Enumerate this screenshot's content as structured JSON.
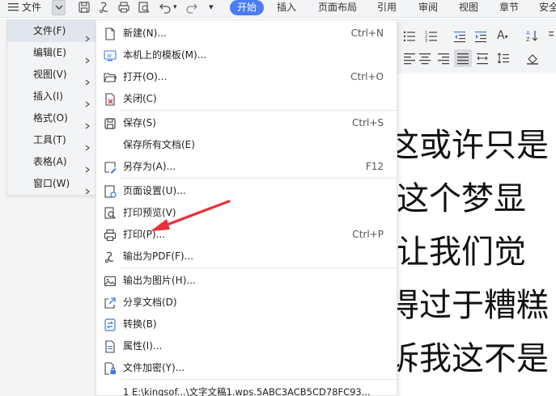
{
  "toolbar": {
    "file_label": "文件",
    "tab_start": "开始",
    "tabs": [
      "插入",
      "页面布局",
      "引用",
      "审阅",
      "视图",
      "章节",
      "安全"
    ]
  },
  "left_menu": {
    "items": [
      {
        "label": "文件(F)",
        "active": true
      },
      {
        "label": "编辑(E)"
      },
      {
        "label": "视图(V)"
      },
      {
        "label": "插入(I)"
      },
      {
        "label": "格式(O)"
      },
      {
        "label": "工具(T)"
      },
      {
        "label": "表格(A)"
      },
      {
        "label": "窗口(W)"
      }
    ]
  },
  "file_menu": {
    "new": {
      "label": "新建(N)...",
      "shortcut": "Ctrl+N"
    },
    "template": {
      "label": "本机上的模板(M)..."
    },
    "open": {
      "label": "打开(O)...",
      "shortcut": "Ctrl+O"
    },
    "close": {
      "label": "关闭(C)"
    },
    "save": {
      "label": "保存(S)",
      "shortcut": "Ctrl+S"
    },
    "save_all": {
      "label": "保存所有文档(E)"
    },
    "save_as": {
      "label": "另存为(A)...",
      "shortcut": "F12"
    },
    "page_setup": {
      "label": "页面设置(U)..."
    },
    "print_preview": {
      "label": "打印预览(V)"
    },
    "print": {
      "label": "打印(P)...",
      "shortcut": "Ctrl+P"
    },
    "export_pdf": {
      "label": "输出为PDF(F)..."
    },
    "export_image": {
      "label": "输出为图片(H)..."
    },
    "share": {
      "label": "分享文档(D)"
    },
    "convert": {
      "label": "转换(B)"
    },
    "properties": {
      "label": "属性(I)..."
    },
    "encrypt": {
      "label": "文件加密(Y)..."
    },
    "recent": "1 E:\\kingsof...\\文字文稿1.wps.5ABC3ACB5CD78FC93..."
  },
  "document": {
    "lines": [
      "这或许只是",
      "这个梦显",
      "让我们觉",
      "得过于糟糕",
      "诉我这不是"
    ]
  },
  "colors": {
    "accent": "#4b7cf0",
    "arrow": "#e8303a",
    "icon_blue": "#3f79e6"
  }
}
